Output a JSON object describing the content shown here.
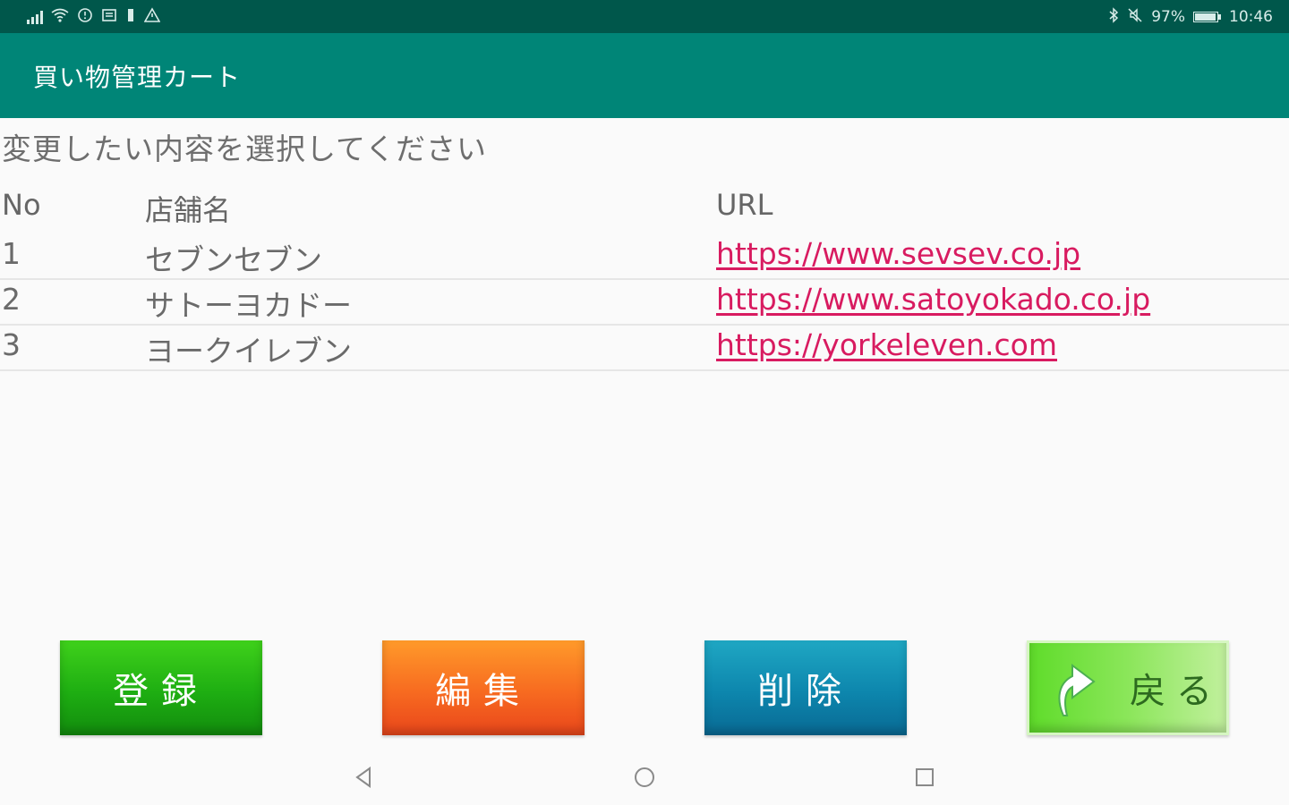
{
  "status_bar": {
    "battery_text": "97%",
    "time": "10:46"
  },
  "app_bar": {
    "title": "買い物管理カート"
  },
  "instruction": "変更したい内容を選択してください",
  "table": {
    "headers": {
      "no": "No",
      "name": "店舗名",
      "url": "URL"
    },
    "rows": [
      {
        "no": "1",
        "name": "セブンセブン",
        "url": "https://www.sevsev.co.jp"
      },
      {
        "no": "2",
        "name": "サトーヨカドー",
        "url": "https://www.satoyokado.co.jp"
      },
      {
        "no": "3",
        "name": "ヨークイレブン",
        "url": "https://yorkeleven.com"
      }
    ]
  },
  "buttons": {
    "register": "登録",
    "edit": "編集",
    "delete": "削除",
    "back": "戻る"
  },
  "colors": {
    "status_bar": "#00574b",
    "app_bar": "#008577",
    "link": "#d81b60",
    "register": "#1eae12",
    "edit": "#f76a20",
    "delete": "#0d86ad",
    "back": "#8be65a"
  },
  "icons": [
    "signal-icon",
    "wifi-icon",
    "alarm-icon",
    "sim-icon",
    "notification-icon",
    "warning-icon",
    "bluetooth-icon",
    "mute-icon",
    "battery-icon",
    "curved-arrow-icon",
    "nav-back-icon",
    "nav-home-icon",
    "nav-recent-icon"
  ]
}
